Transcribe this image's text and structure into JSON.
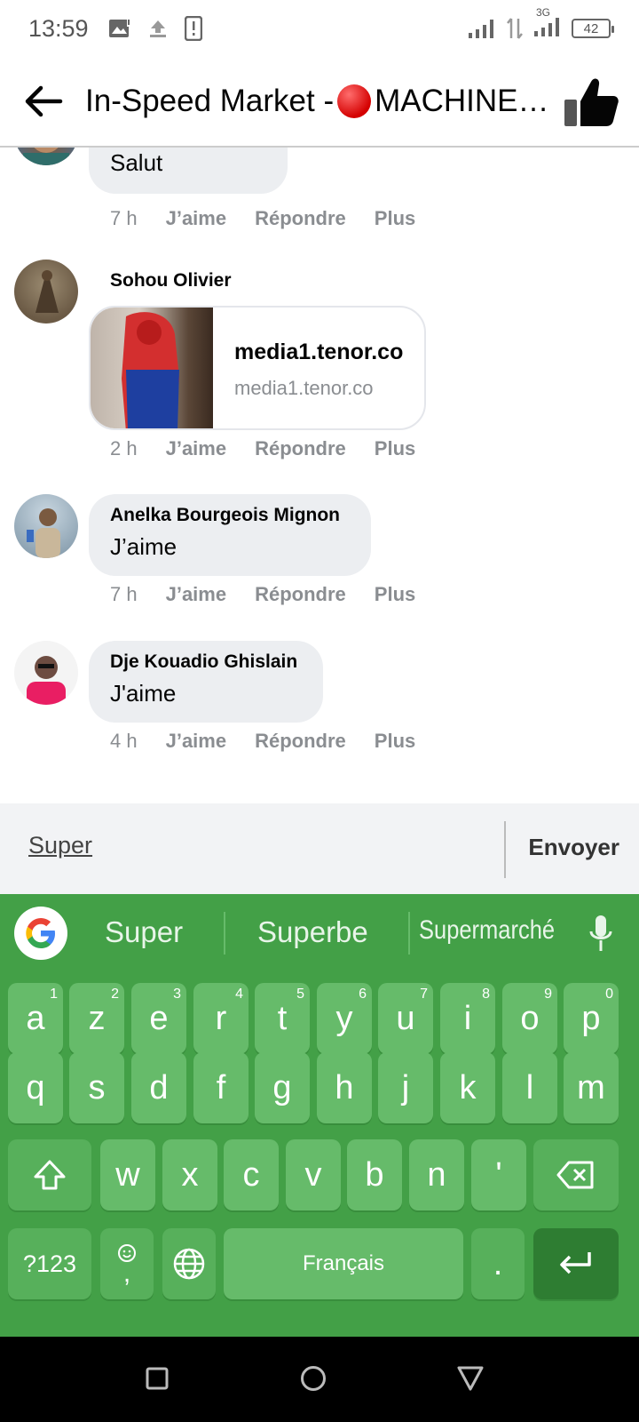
{
  "status_bar": {
    "time": "13:59",
    "network": "3G",
    "battery": "42"
  },
  "header": {
    "title_before": "In-Speed Market - ",
    "title_after": "MACHINE…"
  },
  "comments": [
    {
      "text": "Salut",
      "time": "7 h",
      "like": "J’aime",
      "reply": "Répondre",
      "more": "Plus"
    },
    {
      "author": "Sohou Olivier",
      "link_title": "media1.tenor.co",
      "link_domain": "media1.tenor.co",
      "time": "2 h",
      "like": "J’aime",
      "reply": "Répondre",
      "more": "Plus"
    },
    {
      "author": "Anelka Bourgeois Mignon",
      "text": "J’aime",
      "time": "7 h",
      "like": "J’aime",
      "reply": "Répondre",
      "more": "Plus"
    },
    {
      "author": "Dje Kouadio Ghislain",
      "text": "J'aime",
      "time": "4 h",
      "like": "J’aime",
      "reply": "Répondre",
      "more": "Plus"
    }
  ],
  "composer": {
    "input_value": "Super",
    "send_label": "Envoyer"
  },
  "keyboard": {
    "suggestions": [
      "Super",
      "Superbe",
      "Supermarché"
    ],
    "row1": [
      "a",
      "z",
      "e",
      "r",
      "t",
      "y",
      "u",
      "i",
      "o",
      "p"
    ],
    "row1_sup": [
      "1",
      "2",
      "3",
      "4",
      "5",
      "6",
      "7",
      "8",
      "9",
      "0"
    ],
    "row2": [
      "q",
      "s",
      "d",
      "f",
      "g",
      "h",
      "j",
      "k",
      "l",
      "m"
    ],
    "row3": [
      "w",
      "x",
      "c",
      "v",
      "b",
      "n",
      "'"
    ],
    "symbols": "?123",
    "comma": ",",
    "space": "Français",
    "period": "."
  },
  "colors": {
    "keyboard_bg": "#43a047",
    "key": "#66bb6a",
    "enter_key": "#2e7d32"
  }
}
